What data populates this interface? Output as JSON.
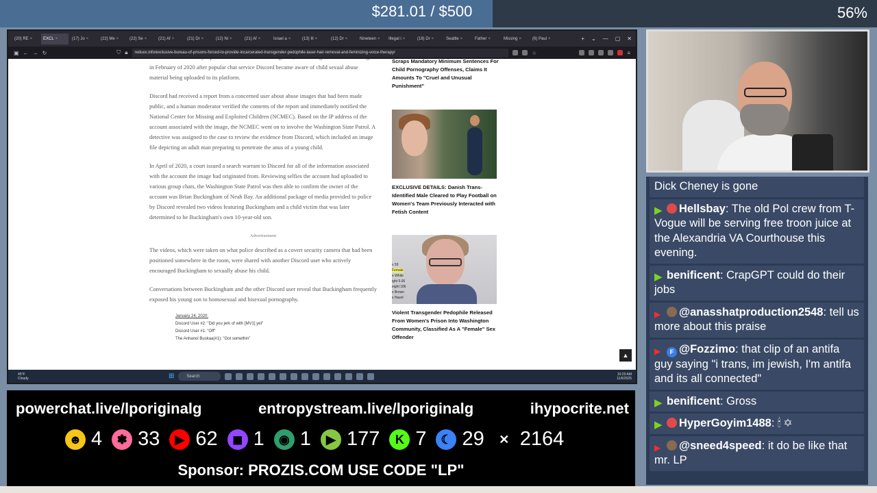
{
  "donation": {
    "text": "$281.01 / $500",
    "fraction": 0.562,
    "percent": "56%"
  },
  "browser": {
    "tabs": [
      "(20) RE",
      "EXCL",
      "(17) Jo",
      "(22) Me",
      "(22) Se",
      "(21) Af",
      "(21) Dr",
      "(12) Ni",
      "(21) Af",
      "Israel a",
      "(13) Ill",
      "(12) Dr",
      "Nineteen",
      "Illegal i",
      "(18) Dr",
      "Seattle",
      "Father",
      "Missing",
      "(6) Paul"
    ],
    "url": "reduxx.info/exclusive-bureau-of-prisons-forced-to-provide-incarcerated-transgender-pedophile-laser-hair-removal-and-feminizing-voice-therapy/"
  },
  "article": {
    "p0": "Reduxx can exclusively report details from the disturbing case, the investigation into which began in February of 2020 after popular chat service Discord became aware of child sexual abuse material being uploaded to its platform.",
    "p1": "Discord had received a report from a concerned user about abuse images that had been made public, and a human moderator verified the contents of the report and immediately notified the National Center for Missing and Exploited Children (NCMEC). Based on the IP address of the account associated with the image, the NCMEC went on to involve the Washington State Patrol. A detective was assigned to the case to review the evidence from Discord, which included an image file depicting an adult man preparing to penetrate the anus of a young child.",
    "p2": "In April of 2020, a court issued a search warrant to Discord for all of the information associated with the account the image had originated from. Reviewing selfies the account had uploaded to various group chats, the Washington State Patrol was then able to confirm the owner of the account was Brian Buckingham of Neah Bay. An additional package of media provided to police by Discord revealed two videos featuring Buckingham and a child victim that was later determined to be Buckingham's own 10-year-old son.",
    "ad": "Advertisement",
    "p3": "The videos, which were taken on what police described as a covert security camera that had been positioned somewhere in the room, were shared with another Discord user who actively encouraged Buckingham to sexually abuse his child.",
    "p4": "Conversations between Buckingham and the other Discord user reveal that Buckingham frequently exposed his young son to homosexual and bisexual pornography.",
    "quote": [
      "January 24, 2020:",
      "Discord User #2: \"Did you jerk of with [MV1] yet\"",
      "Discord User #1: \"Off\"",
      "The Anhanol Buskaa(#1): \"Got somethin\""
    ]
  },
  "sidebar": {
    "h1": "Scraps Mandatory Minimum Sentences For Child Pornography Offenses, Claims It Amounts To \"Cruel and Unusual Punishment\"",
    "h2": "EXCLUSIVE DETAILS: Danish Trans-Identified Male Cleared to Play Football on Women's Team Previously Interacted with Fetish Content",
    "h3": "Violent Transgender Pedophile Released From Women's Prison Into Washington Community, Classified As A \"Female\" Sex Offender",
    "card": [
      "x 59",
      "Female",
      "e White",
      "ight 5.06",
      "eight 186",
      "s Brown",
      "s Hazel"
    ]
  },
  "taskbar": {
    "weather": "45°F Cloudy",
    "search": "Search",
    "time": "10:29 AM",
    "date": "11/6/2025"
  },
  "chat": [
    {
      "platform": "none",
      "badge": "none",
      "user": "",
      "text": "Dick Cheney is gone"
    },
    {
      "platform": "rumble",
      "badge": "red",
      "user": "Hellsbay",
      "text": "The old Pol crew from T- Vogue will be serving free troon juice at the Alexandria VA Courthouse this evening."
    },
    {
      "platform": "rumble",
      "badge": "none",
      "user": "benificent",
      "text": "CrapGPT could do their jobs"
    },
    {
      "platform": "youtube",
      "badge": "brown",
      "user": "@anasshatproduction2548",
      "text": "tell us more about this praise"
    },
    {
      "platform": "youtube",
      "badge": "blue",
      "badge_letter": "F",
      "user": "@Fozzimo",
      "text": "that clip of an antifa guy saying \"i trans, im jewish, I'm antifa and its all connected\""
    },
    {
      "platform": "rumble",
      "badge": "none",
      "user": "benificent",
      "text": "Gross"
    },
    {
      "platform": "rumble",
      "badge": "red",
      "user": "HyperGoyim1488",
      "text": "🕯 ✡"
    },
    {
      "platform": "youtube",
      "badge": "brown",
      "user": "@sneed4speed",
      "text": "it do be like that mr. LP"
    }
  ],
  "overlay": {
    "links": [
      "powerchat.live/lporiginalg",
      "entropystream.live/lporiginalg",
      "ihypocrite.net"
    ],
    "counts": [
      {
        "icon": "robot-icon",
        "color": "#f5c518",
        "glyph": "☻",
        "value": "4"
      },
      {
        "icon": "pinwheel-icon",
        "color": "#ff6b9a",
        "glyph": "✽",
        "value": "33"
      },
      {
        "icon": "youtube-icon",
        "color": "#ff0000",
        "glyph": "▶",
        "value": "62"
      },
      {
        "icon": "twitch-icon",
        "color": "#9146ff",
        "glyph": "◼",
        "value": "1"
      },
      {
        "icon": "orb-icon",
        "color": "#2f9e6e",
        "glyph": "◉",
        "value": "1"
      },
      {
        "icon": "rumble-icon",
        "color": "#85c742",
        "glyph": "▶",
        "value": "177"
      },
      {
        "icon": "kick-icon",
        "color": "#53fc18",
        "glyph": "K",
        "value": "7"
      },
      {
        "icon": "moon-icon",
        "color": "#3b82f6",
        "glyph": "☾",
        "value": "29"
      },
      {
        "icon": "x-icon",
        "color": "#ffffff",
        "glyph": "✕",
        "value": "2164"
      }
    ],
    "sponsor": "Sponsor: PROZIS.COM USE CODE \"LP\""
  }
}
